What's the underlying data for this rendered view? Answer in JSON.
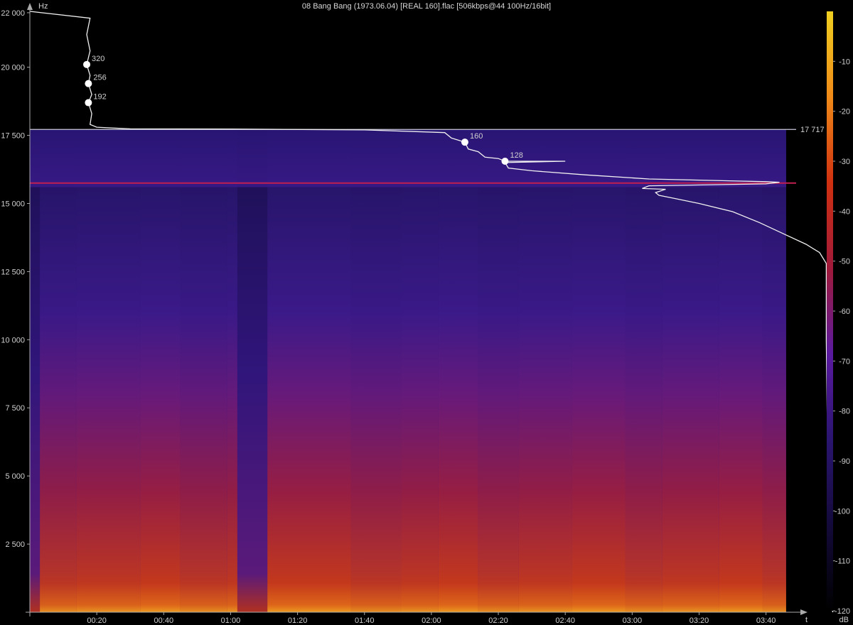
{
  "chart_data": {
    "type": "heatmap",
    "title": "08 Bang Bang (1973.06.04) [REAL 160].flac [506kbps@44 100Hz/16bit]",
    "ylabel": "Hz",
    "xlabel": "t",
    "colorbar_label": "dB",
    "x_unit": "seconds",
    "xlim": [
      0,
      229
    ],
    "ylim": [
      0,
      22050
    ],
    "y_ticks": [
      {
        "value": 2500,
        "label": "2 500"
      },
      {
        "value": 5000,
        "label": "5 000"
      },
      {
        "value": 7500,
        "label": "7 500"
      },
      {
        "value": 10000,
        "label": "10 000"
      },
      {
        "value": 12500,
        "label": "12 500"
      },
      {
        "value": 15000,
        "label": "15 000"
      },
      {
        "value": 17500,
        "label": "17 500"
      },
      {
        "value": 20000,
        "label": "20 000"
      },
      {
        "value": 22000,
        "label": "22 000"
      }
    ],
    "x_ticks": [
      {
        "value": 20,
        "label": "00:20"
      },
      {
        "value": 40,
        "label": "00:40"
      },
      {
        "value": 60,
        "label": "01:00"
      },
      {
        "value": 80,
        "label": "01:20"
      },
      {
        "value": 100,
        "label": "01:40"
      },
      {
        "value": 120,
        "label": "02:00"
      },
      {
        "value": 140,
        "label": "02:20"
      },
      {
        "value": 160,
        "label": "02:40"
      },
      {
        "value": 180,
        "label": "03:00"
      },
      {
        "value": 200,
        "label": "03:20"
      },
      {
        "value": 220,
        "label": "03:40"
      }
    ],
    "colorbar_range": [
      -120,
      0
    ],
    "colorbar_ticks": [
      {
        "value": -10,
        "label": "-10"
      },
      {
        "value": -20,
        "label": "-20"
      },
      {
        "value": -30,
        "label": "-30"
      },
      {
        "value": -40,
        "label": "-40"
      },
      {
        "value": -50,
        "label": "-50"
      },
      {
        "value": -60,
        "label": "-60"
      },
      {
        "value": -70,
        "label": "-70"
      },
      {
        "value": -80,
        "label": "-80"
      },
      {
        "value": -90,
        "label": "-90"
      },
      {
        "value": -100,
        "label": "-100"
      },
      {
        "value": -110,
        "label": "-110"
      },
      {
        "value": -120,
        "label": "-120"
      }
    ],
    "colormap": [
      "#000000",
      "#140a3a",
      "#2a1570",
      "#5a1aa0",
      "#a01a3a",
      "#d03010",
      "#f08a18",
      "#f0d020"
    ],
    "cutoff": {
      "value": 17717,
      "label": "17 717",
      "color": "#c8c8d8"
    },
    "hum_line": {
      "value": 15750,
      "color": "#c02050"
    },
    "bitrate_markers": [
      {
        "label": "320",
        "time": 17,
        "freq": 20100
      },
      {
        "label": "256",
        "time": 17.5,
        "freq": 19400
      },
      {
        "label": "192",
        "time": 17.5,
        "freq": 18700
      },
      {
        "label": "160",
        "time": 130,
        "freq": 17250
      },
      {
        "label": "128",
        "time": 142,
        "freq": 16550
      }
    ],
    "energy_profile": [
      [
        0,
        22050
      ],
      [
        18,
        21800
      ],
      [
        17,
        21200
      ],
      [
        18,
        20600
      ],
      [
        17,
        20100
      ],
      [
        18,
        19700
      ],
      [
        17.5,
        19400
      ],
      [
        18.5,
        19000
      ],
      [
        17.5,
        18700
      ],
      [
        18.5,
        18300
      ],
      [
        18,
        17900
      ],
      [
        20,
        17800
      ],
      [
        30,
        17740
      ],
      [
        60,
        17730
      ],
      [
        100,
        17700
      ],
      [
        124,
        17600
      ],
      [
        126,
        17400
      ],
      [
        130,
        17250
      ],
      [
        131,
        17000
      ],
      [
        134,
        16900
      ],
      [
        136,
        16700
      ],
      [
        140,
        16650
      ],
      [
        142,
        16550
      ],
      [
        160,
        16550
      ],
      [
        142,
        16500
      ],
      [
        143,
        16300
      ],
      [
        150,
        16200
      ],
      [
        166,
        16050
      ],
      [
        185,
        15900
      ],
      [
        220,
        15800
      ],
      [
        224,
        15780
      ],
      [
        220,
        15720
      ],
      [
        185,
        15650
      ],
      [
        183,
        15550
      ],
      [
        190,
        15520
      ],
      [
        187,
        15400
      ],
      [
        188,
        15300
      ],
      [
        192,
        15200
      ],
      [
        200,
        15000
      ],
      [
        210,
        14700
      ],
      [
        218,
        14300
      ],
      [
        225,
        13900
      ],
      [
        232,
        13500
      ],
      [
        236,
        13200
      ],
      [
        238,
        12800
      ],
      [
        238,
        10000
      ],
      [
        238.5,
        5000
      ],
      [
        238.5,
        1000
      ],
      [
        239,
        300
      ],
      [
        240,
        0
      ]
    ],
    "loud_segments": [
      [
        3,
        14
      ],
      [
        14,
        33
      ],
      [
        33,
        45
      ],
      [
        45,
        59
      ],
      [
        59,
        62
      ],
      [
        71,
        96
      ],
      [
        96,
        111
      ],
      [
        111,
        122
      ],
      [
        122,
        134
      ],
      [
        134,
        146
      ],
      [
        146,
        162
      ],
      [
        162,
        178
      ],
      [
        178,
        189
      ],
      [
        189,
        206
      ],
      [
        206,
        219
      ],
      [
        219,
        226
      ]
    ]
  }
}
